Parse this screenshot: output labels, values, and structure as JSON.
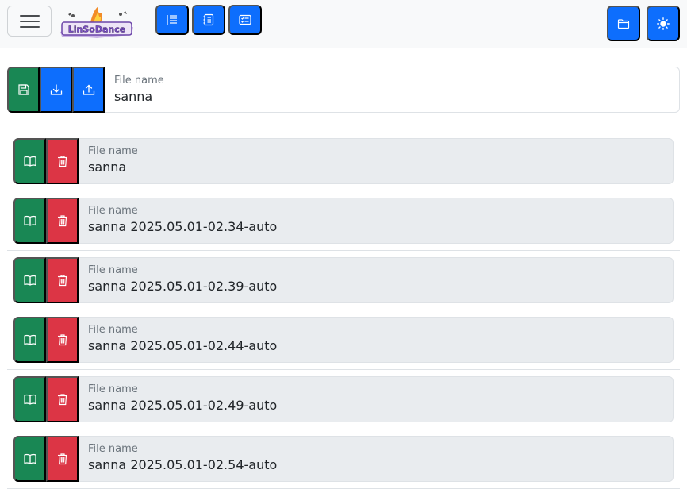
{
  "navbar": {
    "toggler_label": "Toggle navigation",
    "logo_alt": "LinSoDance",
    "buttons": [
      {
        "icon": "list-indent-icon"
      },
      {
        "icon": "journal-icon"
      },
      {
        "icon": "card-checklist-icon"
      }
    ],
    "right_buttons": [
      {
        "icon": "folder-icon"
      },
      {
        "icon": "sun-icon"
      }
    ]
  },
  "current_file": {
    "label": "File name",
    "value": "sanna",
    "actions": [
      "save-icon",
      "download-icon",
      "upload-icon"
    ]
  },
  "files": [
    {
      "label": "File name",
      "value": "sanna"
    },
    {
      "label": "File name",
      "value": "sanna 2025.05.01-02.34-auto"
    },
    {
      "label": "File name",
      "value": "sanna 2025.05.01-02.39-auto"
    },
    {
      "label": "File name",
      "value": "sanna 2025.05.01-02.44-auto"
    },
    {
      "label": "File name",
      "value": "sanna 2025.05.01-02.49-auto"
    },
    {
      "label": "File name",
      "value": "sanna 2025.05.01-02.54-auto"
    }
  ],
  "colors": {
    "primary": "#0d6efd",
    "success": "#198754",
    "danger": "#dc3545",
    "navbar_bg": "#f8f9fa",
    "readonly_bg": "#e9ecef"
  }
}
